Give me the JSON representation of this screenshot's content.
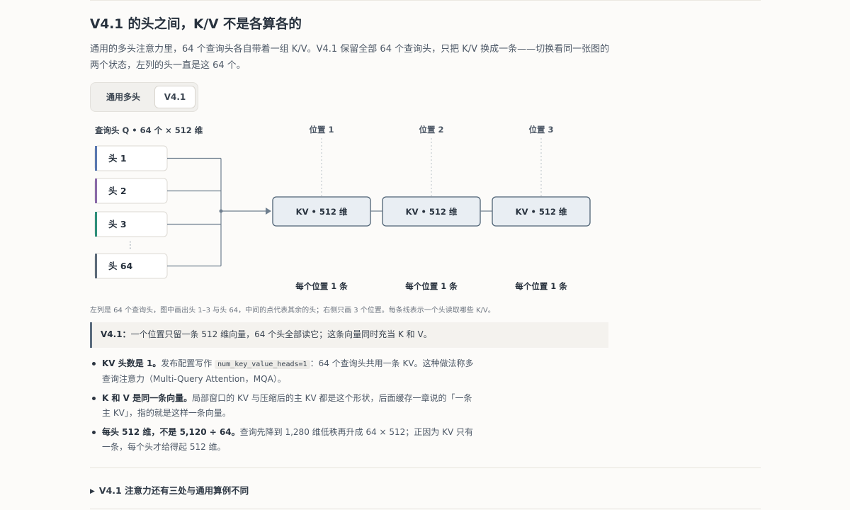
{
  "title": "V4.1 的头之间，K/V 不是各算各的",
  "intro": "通用的多头注意力里，64 个查询头各自带着一组 K/V。V4.1 保留全部 64 个查询头，只把 K/V 换成一条——切换看同一张图的两个状态，左列的头一直是这 64 个。",
  "toggle": {
    "options": [
      "通用多头",
      "V4.1"
    ],
    "selected": "V4.1"
  },
  "diagram": {
    "heads_header": "查询头 Q • 64 个 × 512 维",
    "heads": [
      {
        "label": "头 1",
        "color": "#5a78b0"
      },
      {
        "label": "头 2",
        "color": "#8a6aa8"
      },
      {
        "label": "头 3",
        "color": "#2f8f7a"
      },
      {
        "label": "头 64",
        "color": "#5d6b7a"
      }
    ],
    "ellipsis": "⋮",
    "positions": [
      {
        "label": "位置 1",
        "kv": "KV • 512 维",
        "footer": "每个位置 1 条"
      },
      {
        "label": "位置 2",
        "kv": "KV • 512 维",
        "footer": "每个位置 1 条"
      },
      {
        "label": "位置 3",
        "kv": "KV • 512 维",
        "footer": "每个位置 1 条"
      }
    ],
    "colors": {
      "line": "#6f7f8f",
      "kv_fill": "#e9eef3",
      "kv_stroke": "#4e6274"
    }
  },
  "caption": "左列是 64 个查询头，图中画出头 1–3 与头 64，中间的点代表其余的头；右侧只画 3 个位置。每条线表示一个头读取哪些 K/V。",
  "callout": {
    "label": "V4.1：",
    "text": "一个位置只留一条 512 维向量，64 个头全部读它；这条向量同时充当 K 和 V。"
  },
  "bullets": [
    {
      "bold": "KV 头数是 1。",
      "pre": "发布配置写作 ",
      "code": "num_key_value_heads=1",
      "post": "：64 个查询头共用一条 KV。这种做法称多查询注意力（Multi-Query Attention，MQA）。"
    },
    {
      "bold": "K 和 V 是同一条向量。",
      "pre": "局部窗口的 KV 与压缩后的主 KV 都是这个形状，后面缓存一章说的「一条主 KV」，指的就是这样一条向量。"
    },
    {
      "bold": "每头 512 维，不是 5,120 ÷ 64。",
      "pre": "查询先降到 1,280 维低秩再升成 64 × 512；正因为 KV 只有一条，每个头才给得起 512 维。"
    }
  ],
  "details": {
    "icon": "triangle-right-icon",
    "label": "V4.1 注意力还有三处与通用算例不同"
  }
}
